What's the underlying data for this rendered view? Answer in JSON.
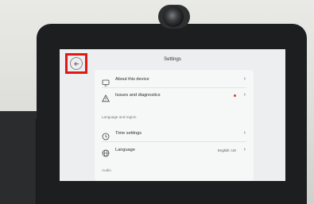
{
  "screen": {
    "title": "Settings"
  },
  "settings": {
    "items": [
      {
        "label": "About this device",
        "icon": "monitor-icon"
      },
      {
        "label": "Issues and diagnostics",
        "icon": "warning-icon",
        "has_alert": true
      },
      {
        "label": "Time settings",
        "icon": "clock-icon"
      },
      {
        "label": "Language",
        "icon": "globe-icon",
        "value": "English: US"
      }
    ],
    "sections": {
      "language_region": "Language and region",
      "audio": "Audio"
    }
  },
  "colors": {
    "highlight": "#e01818",
    "alert_dot": "#e23b2d"
  }
}
